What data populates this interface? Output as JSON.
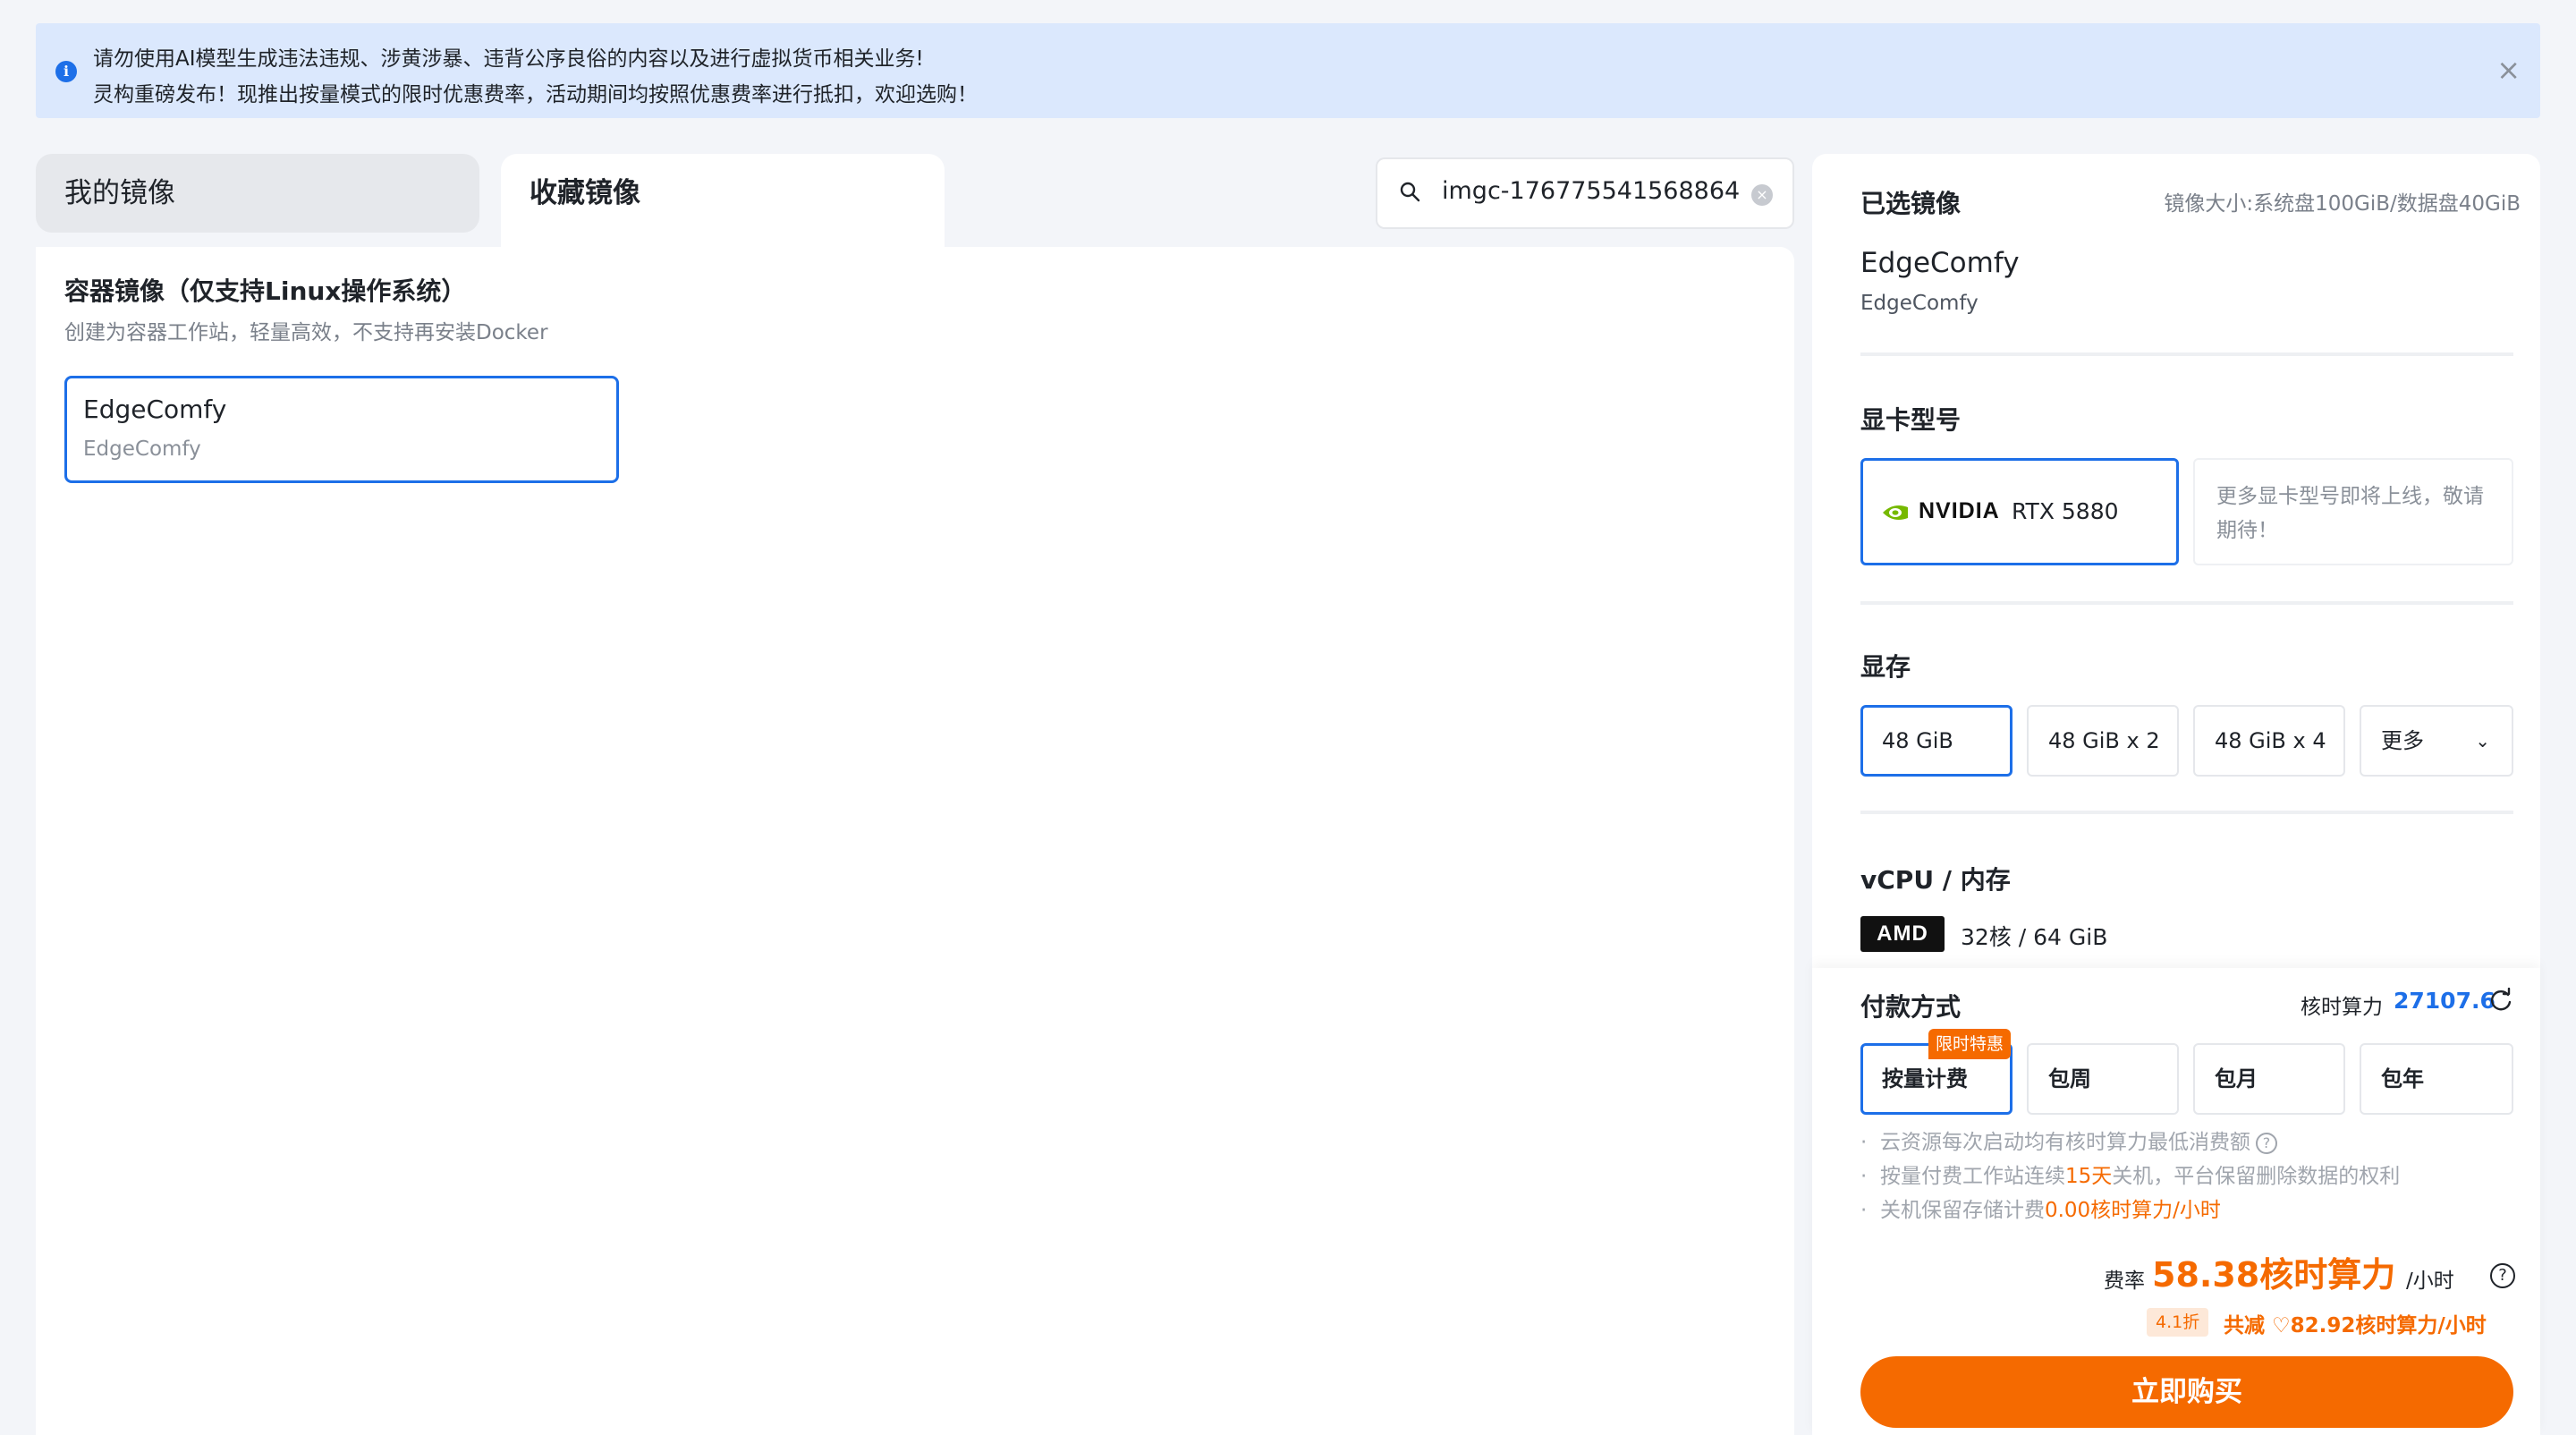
{
  "notice": {
    "line1": "请勿使用AI模型生成违法违规、涉黄涉暴、违背公序良俗的内容以及进行虚拟货币相关业务!",
    "line2": "灵构重磅发布！现推出按量模式的限时优惠费率，活动期间均按照优惠费率进行抵扣，欢迎选购！",
    "close": "×",
    "info": "i"
  },
  "tabs": {
    "my": "我的镜像",
    "fav": "收藏镜像"
  },
  "search": {
    "value": "imgc-176775541568864",
    "clear": "×"
  },
  "main": {
    "section_title": "容器镜像（仅支持Linux操作系统）",
    "section_sub": "创建为容器工作站，轻量高效，不支持再安装Docker",
    "image_card": {
      "name": "EdgeComfy",
      "desc": "EdgeComfy"
    }
  },
  "side": {
    "selected_label": "已选镜像",
    "image_size": "镜像大小:系统盘100GiB/数据盘40GiB",
    "selected_name": "EdgeComfy",
    "selected_desc": "EdgeComfy",
    "gpu_label": "显卡型号",
    "gpu_brand": "NVIDIA",
    "gpu_model": "RTX 5880",
    "gpu_more": "更多显卡型号即将上线，敬请期待！",
    "vram_label": "显存",
    "vram_options": [
      "48 GiB",
      "48 GiB x 2",
      "48 GiB x 4",
      "更多"
    ],
    "vcpu_label": "vCPU / 内存",
    "cpu_brand": "AMD",
    "cpu_spec": "32核 / 64 GiB"
  },
  "payment": {
    "label": "付款方式",
    "balance_label": "核时算力",
    "balance_value": "27107.6",
    "promo_badge": "限时特惠",
    "options": [
      "按量计费",
      "包周",
      "包月",
      "包年"
    ],
    "notes": {
      "n1": "云资源每次启动均有核时算力最低消费额",
      "n2_pre": "按量付费工作站连续",
      "n2_hl": "15天",
      "n2_post": "关机，平台保留删除数据的权利",
      "n3_pre": "关机保留存储计费",
      "n3_hl": "0.00核时算力/小时"
    },
    "rate_label": "费率",
    "rate_value": "58.38核时算力",
    "rate_unit": "/小时",
    "discount": "4.1折",
    "savings": "共减 ♡82.92核时算力/小时",
    "buy": "立即购买"
  },
  "colors": {
    "accent": "#1d6fe8",
    "orange": "#f56a00",
    "notice_bg": "#dbe8fd"
  }
}
